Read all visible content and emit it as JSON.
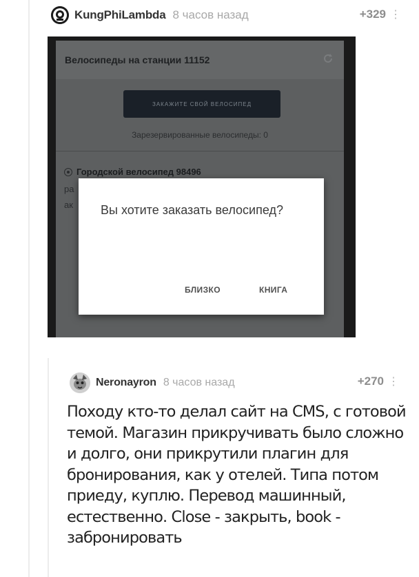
{
  "comments": [
    {
      "username": "KungPhiLambda",
      "timestamp": "8 часов назад",
      "rating": "+329",
      "more_icon": "⋮",
      "screenshot": {
        "title": "Велосипеды на станции 11152",
        "order_button": "ЗАКАЖИТЕ СВОЙ ВЕЛОСИПЕД",
        "reserved": "Зарезервированные велосипеды: 0",
        "bike_item": "Городской велосипед 98496",
        "bike_sub_1": "ра",
        "bike_sub_2": "ак",
        "dialog": {
          "question": "Вы хотите заказать велосипед?",
          "btn_close": "БЛИЗКО",
          "btn_book": "КНИГА"
        }
      }
    },
    {
      "username": "Neronayron",
      "timestamp": "8 часов назад",
      "rating": "+270",
      "more_icon": "⋮",
      "text": "Походу кто-то делал сайт на CMS, с готовой темой. Магазин прикручивать было сложно и долго, они прикрутили плагин для бронирования, как у отелей. Типа потом приеду, куплю. Перевод машинный, естественно. Close - закрыть, book - забронировать"
    }
  ],
  "colors": {
    "accent_rating": "#8d8d8d",
    "timestamp": "#a8a8a8",
    "thread_line": "#ececec"
  }
}
